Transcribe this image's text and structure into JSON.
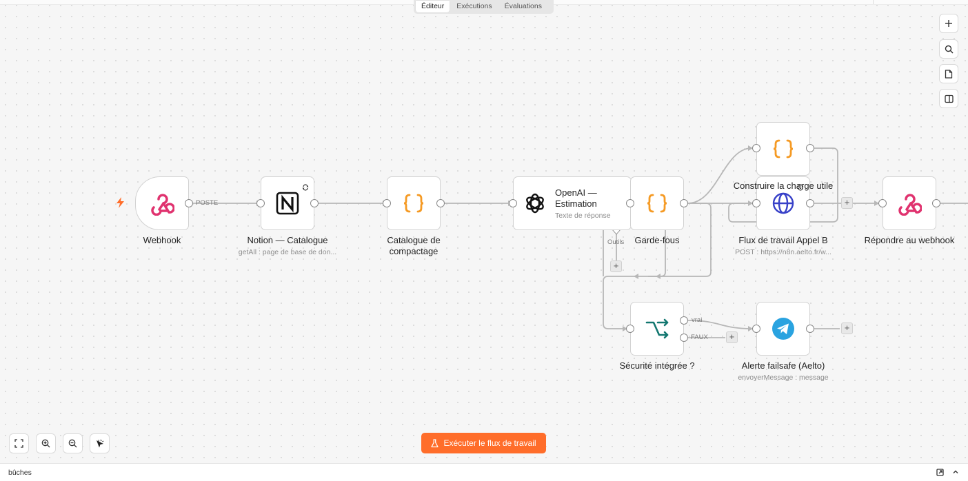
{
  "tabs": [
    "Éditeur",
    "Exécutions",
    "Évaluations"
  ],
  "nodes": {
    "webhook": {
      "label": "Webhook"
    },
    "notion": {
      "label": "Notion — Catalogue",
      "sublabel": "getAll : page de base de don..."
    },
    "catalog": {
      "label_line1": "Catalogue de",
      "label_line2": "compactage"
    },
    "openai": {
      "title_line1": "OpenAI —",
      "title_line2": "Estimation",
      "sub": "Texte de réponse"
    },
    "guardrails": {
      "label": "Garde-fous"
    },
    "payload": {
      "label": "Construire la charge utile"
    },
    "call_b": {
      "label": "Flux de travail Appel B",
      "sublabel": "POST : https://n8n.aelto.fr/w..."
    },
    "respond": {
      "label": "Répondre au webhook"
    },
    "security": {
      "label": "Sécurité intégrée ?"
    },
    "alert": {
      "label": "Alerte failsafe (Aelto)",
      "sublabel": "envoyerMessage : message"
    }
  },
  "edge_labels": {
    "post": "POSTE",
    "tools": "Outils",
    "true": "vrai",
    "false": "FAUX"
  },
  "execute_button": "Exécuter le flux de travail",
  "footer": {
    "text": "bûches"
  },
  "colors": {
    "accent": "#ff6d2a",
    "webhook": "#e0336f",
    "code": "#f59a24",
    "router": "#127770",
    "http": "#3740c8",
    "telegram": "#2aa3e0"
  },
  "icons": {
    "side": [
      "plus-icon",
      "search-icon",
      "sticky-note-icon",
      "panel-icon"
    ],
    "zoom": [
      "fit-view-icon",
      "zoom-in-icon",
      "zoom-out-icon",
      "tidy-up-icon"
    ]
  }
}
